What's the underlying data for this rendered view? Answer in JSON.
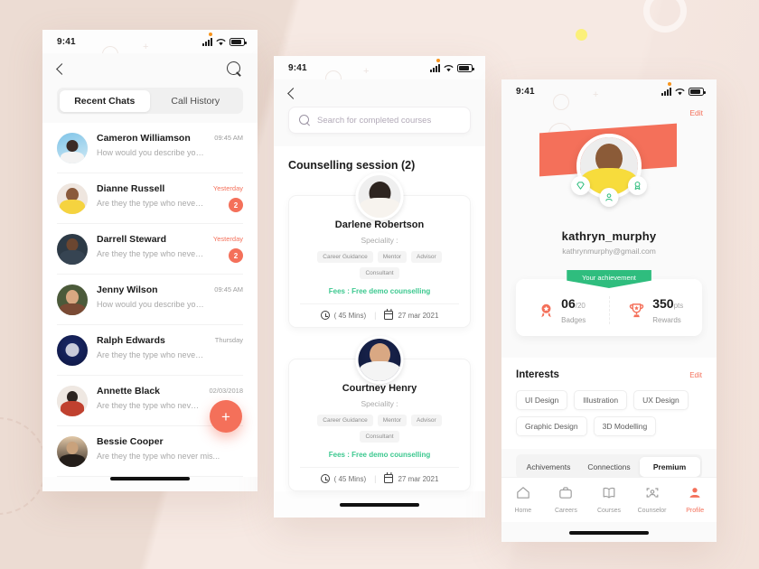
{
  "background": {
    "base_color": "#f2e3db",
    "accent_yellow": "#fbf07a",
    "accent_coral": "#f4705a",
    "accent_green": "#2fbd7e"
  },
  "status_bar": {
    "time": "9:41"
  },
  "screen1": {
    "name": "recent-chats",
    "nav": {
      "back_icon": "chevron-left-icon",
      "search_icon": "search-icon"
    },
    "tabs": [
      {
        "label": "Recent Chats",
        "active": true
      },
      {
        "label": "Call History",
        "active": false
      }
    ],
    "fab_label": "+",
    "chats": [
      {
        "name": "Cameron Williamson",
        "message": "How would you describe yourself..",
        "time": "09:45 AM",
        "highlight": false,
        "unread": ""
      },
      {
        "name": "Dianne Russell",
        "message": "Are they the type who never mis...",
        "time": "Yesterday",
        "highlight": true,
        "unread": "2"
      },
      {
        "name": "Darrell Steward",
        "message": "Are they the type who never mis...",
        "time": "Yesterday",
        "highlight": true,
        "unread": "2"
      },
      {
        "name": "Jenny Wilson",
        "message": "How would you describe yourself..",
        "time": "09:45 AM",
        "highlight": false,
        "unread": ""
      },
      {
        "name": "Ralph Edwards",
        "message": "Are they the type who never mis...",
        "time": "Thursday",
        "highlight": false,
        "unread": ""
      },
      {
        "name": "Annette Black",
        "message": "Are they the type who never mis...",
        "time": "02/03/2018",
        "highlight": false,
        "unread": ""
      },
      {
        "name": "Bessie Cooper",
        "message": "Are they the type who never mis...",
        "time": "",
        "highlight": false,
        "unread": ""
      }
    ]
  },
  "screen2": {
    "name": "counselling-sessions",
    "nav": {
      "back_icon": "chevron-left-icon"
    },
    "search": {
      "placeholder": "Search for completed courses",
      "icon": "search-icon"
    },
    "section_title": "Counselling session (2)",
    "cards": [
      {
        "name": "Darlene Robertson",
        "speciality_label": "Speciality :",
        "tags": [
          "Career Guidance",
          "Mentor",
          "Advisor",
          "Consultant"
        ],
        "fees": "Fees : Free demo counselling",
        "duration": "( 45 Mins)",
        "date": "27 mar 2021"
      },
      {
        "name": "Courtney Henry",
        "speciality_label": "Speciality :",
        "tags": [
          "Career Guidance",
          "Mentor",
          "Advisor",
          "Consultant"
        ],
        "fees": "Fees : Free demo counselling",
        "duration": "( 45 Mins)",
        "date": "27 mar 2021"
      }
    ]
  },
  "screen3": {
    "name": "user-profile",
    "edit_top_label": "Edit",
    "username": "kathryn_murphy",
    "email": "kathrynmurphy@gmail.com",
    "badges_icons": [
      "diamond-icon",
      "person-badge-icon",
      "award-ribbon-icon"
    ],
    "achievement": {
      "ribbon_label": "Your achievement",
      "stats": [
        {
          "icon": "star-medal-icon",
          "value": "06",
          "unit": "/20",
          "label": "Badges"
        },
        {
          "icon": "trophy-icon",
          "value": "350",
          "unit": "pts",
          "label": "Rewards"
        }
      ]
    },
    "interests": {
      "title": "Interests",
      "edit_label": "Edit",
      "chips": [
        "UI Design",
        "Illustration",
        "UX Design",
        "Graphic Design",
        "3D Modelling"
      ]
    },
    "segments": [
      {
        "label": "Achivements",
        "active": false
      },
      {
        "label": "Connections",
        "active": false
      },
      {
        "label": "Premium",
        "active": true
      }
    ],
    "tabbar": [
      {
        "label": "Home",
        "icon": "home-icon",
        "active": false
      },
      {
        "label": "Careers",
        "icon": "briefcase-icon",
        "active": false
      },
      {
        "label": "Courses",
        "icon": "book-icon",
        "active": false
      },
      {
        "label": "Counselor",
        "icon": "person-scan-icon",
        "active": false
      },
      {
        "label": "Profile",
        "icon": "person-icon",
        "active": true
      }
    ]
  }
}
